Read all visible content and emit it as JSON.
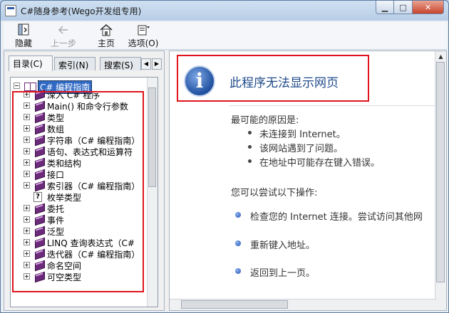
{
  "window": {
    "title": "C#随身参考(Wego开发组专用)"
  },
  "toolbar": {
    "buttons": [
      {
        "label": "隐藏",
        "icon": "hide-pane-icon",
        "enabled": true
      },
      {
        "label": "上一步",
        "icon": "back-arrow-icon",
        "enabled": false
      },
      {
        "label": "主页",
        "icon": "home-icon",
        "enabled": true
      },
      {
        "label": "选项(O)",
        "icon": "options-icon",
        "enabled": true
      }
    ]
  },
  "tabs": [
    {
      "label": "目录(C)",
      "active": true
    },
    {
      "label": "索引(N)",
      "active": false
    },
    {
      "label": "搜索(S)",
      "active": false
    }
  ],
  "tree": {
    "root": "C# 编程指南",
    "items": [
      {
        "label": "深入 C# 程序",
        "type": "book"
      },
      {
        "label": "Main() 和命令行参数",
        "type": "book"
      },
      {
        "label": "类型",
        "type": "book"
      },
      {
        "label": "数组",
        "type": "book"
      },
      {
        "label": "字符串（C# 编程指南）",
        "type": "book"
      },
      {
        "label": "语句、表达式和运算符",
        "type": "book"
      },
      {
        "label": "类和结构",
        "type": "book"
      },
      {
        "label": "接口",
        "type": "book"
      },
      {
        "label": "索引器（C# 编程指南）",
        "type": "book"
      },
      {
        "label": "枚举类型",
        "type": "page"
      },
      {
        "label": "委托",
        "type": "book"
      },
      {
        "label": "事件",
        "type": "book"
      },
      {
        "label": "泛型",
        "type": "book"
      },
      {
        "label": "LINQ 查询表达式（C#",
        "type": "book"
      },
      {
        "label": "迭代器（C# 编程指南）",
        "type": "book"
      },
      {
        "label": "命名空间",
        "type": "book"
      },
      {
        "label": "可空类型",
        "type": "book"
      }
    ]
  },
  "content": {
    "title": "此程序无法显示网页",
    "reasons_heading": "最可能的原因是:",
    "reasons": [
      "未连接到 Internet。",
      "该网站遇到了问题。",
      "在地址中可能存在键入错误。"
    ],
    "actions_heading": "您可以尝试以下操作:",
    "actions": [
      "检查您的 Internet 连接。尝试访问其他网",
      "重新键入地址。",
      "返回到上一页。"
    ]
  },
  "colors": {
    "highlight_box": "#e0141c",
    "link_blue": "#1f4a8a",
    "selection": "#316ac5"
  }
}
